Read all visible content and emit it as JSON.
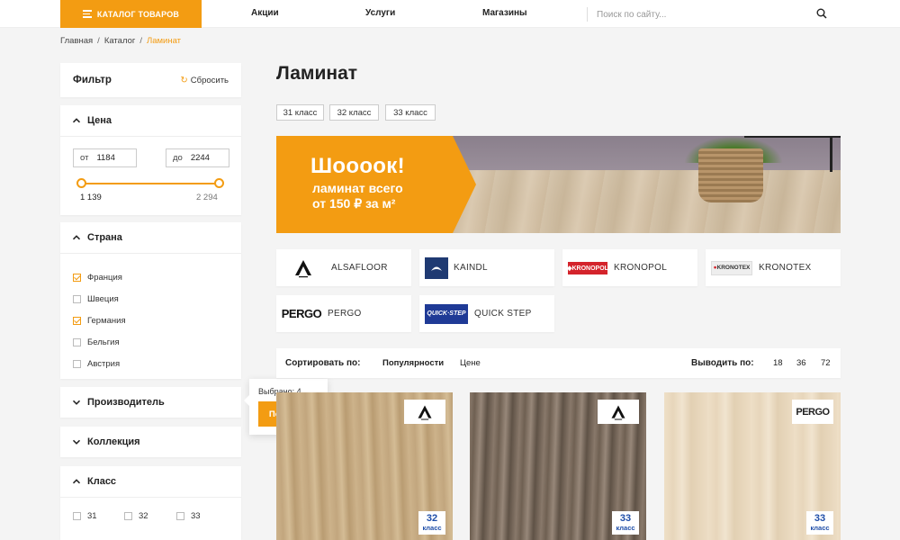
{
  "header": {
    "catalog_label": "КАТАЛОГ ТОВАРОВ",
    "nav": [
      "Акции",
      "Услуги",
      "Магазины"
    ],
    "search_placeholder": "Поиск по сайту..."
  },
  "breadcrumb": [
    "Главная",
    "Каталог",
    "Ламинат"
  ],
  "filter": {
    "title": "Фильтр",
    "reset_label": "Сбросить",
    "price": {
      "label": "Цена",
      "from_prefix": "от",
      "from_value": "1184",
      "to_prefix": "до",
      "to_value": "2244",
      "min": "1 139",
      "max": "2 294"
    },
    "country": {
      "label": "Страна",
      "options": [
        {
          "label": "Франция",
          "checked": true
        },
        {
          "label": "Швеция",
          "checked": false
        },
        {
          "label": "Германия",
          "checked": true
        },
        {
          "label": "Бельгия",
          "checked": false
        },
        {
          "label": "Австрия",
          "checked": false
        }
      ]
    },
    "manufacturer_label": "Производитель",
    "collection_label": "Коллекция",
    "class": {
      "label": "Класс",
      "options": [
        "31",
        "32",
        "33"
      ]
    }
  },
  "popup": {
    "selected_text": "Выбрано: 4",
    "show_label": "Показать"
  },
  "main": {
    "title": "Ламинат",
    "class_tags": [
      "31 класс",
      "32 класс",
      "33 класс"
    ],
    "banner": {
      "line1": "Шоооок!",
      "line2": "ламинат всего",
      "line3": "от 150 ₽ за м²"
    },
    "brands": [
      {
        "name": "ALSAFLOOR"
      },
      {
        "name": "KAINDL"
      },
      {
        "name": "KRONOPOL"
      },
      {
        "name": "KRONOTEX"
      },
      {
        "name": "PERGO"
      },
      {
        "name": "QUICK STEP"
      }
    ],
    "sort": {
      "label": "Сортировать по:",
      "options": [
        "Популярности",
        "Цене"
      ],
      "per_page_label": "Выводить по:",
      "per_page": [
        "18",
        "36",
        "72"
      ]
    },
    "products": [
      {
        "brand": "ALSAFLOOR",
        "class_num": "32",
        "class_word": "класс"
      },
      {
        "brand": "ALSAFLOOR",
        "class_num": "33",
        "class_word": "класс"
      },
      {
        "brand": "PERGO",
        "class_num": "33",
        "class_word": "класс"
      }
    ]
  },
  "colors": {
    "accent": "#f39c12",
    "badge_text": "#1f4ea8"
  }
}
